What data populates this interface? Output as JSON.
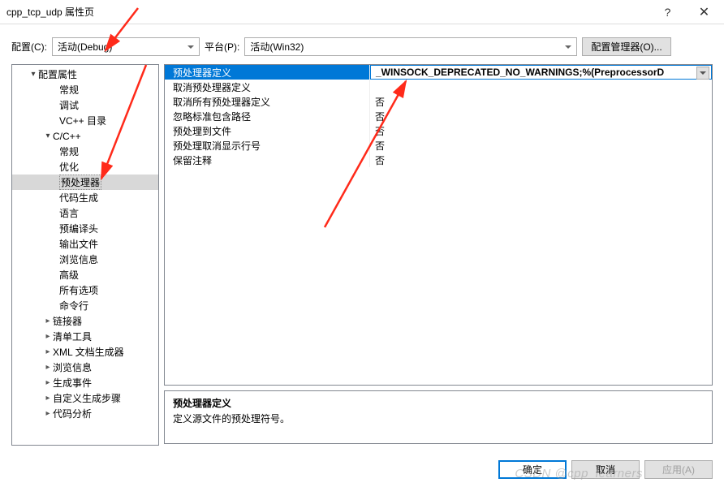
{
  "window": {
    "title": "cpp_tcp_udp 属性页"
  },
  "toolbar": {
    "config_label": "配置(C):",
    "config_value": "活动(Debug)",
    "platform_label": "平台(P):",
    "platform_value": "活动(Win32)",
    "manager_btn": "配置管理器(O)..."
  },
  "tree": {
    "root": "配置属性",
    "items": [
      "常规",
      "调试",
      "VC++ 目录"
    ],
    "cpp": {
      "label": "C/C++",
      "children": [
        "常规",
        "优化",
        "预处理器",
        "代码生成",
        "语言",
        "预编译头",
        "输出文件",
        "浏览信息",
        "高级",
        "所有选项",
        "命令行"
      ]
    },
    "rest": [
      "链接器",
      "清单工具",
      "XML 文档生成器",
      "浏览信息",
      "生成事件",
      "自定义生成步骤",
      "代码分析"
    ]
  },
  "grid": {
    "rows": [
      {
        "k": "预处理器定义",
        "v": "_WINSOCK_DEPRECATED_NO_WARNINGS;%(PreprocessorD"
      },
      {
        "k": "取消预处理器定义",
        "v": ""
      },
      {
        "k": "取消所有预处理器定义",
        "v": "否"
      },
      {
        "k": "忽略标准包含路径",
        "v": "否"
      },
      {
        "k": "预处理到文件",
        "v": "否"
      },
      {
        "k": "预处理取消显示行号",
        "v": "否"
      },
      {
        "k": "保留注释",
        "v": "否"
      }
    ]
  },
  "desc": {
    "title": "预处理器定义",
    "body": "定义源文件的预处理符号。"
  },
  "footer": {
    "ok": "确定",
    "cancel": "取消",
    "apply": "应用(A)"
  },
  "watermark": "CSDN @cpp_learners"
}
